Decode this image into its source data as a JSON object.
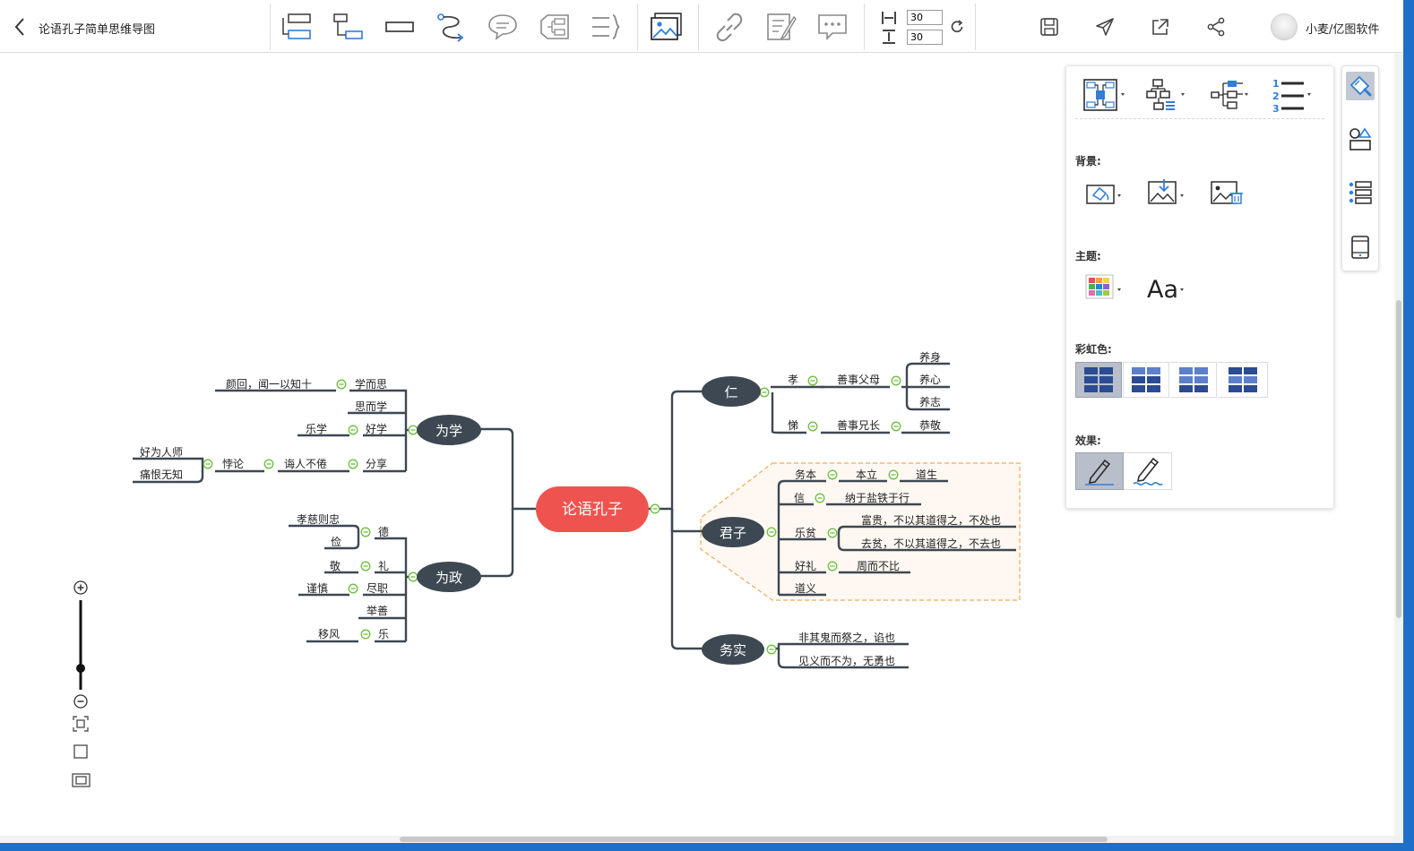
{
  "toolbar": {
    "title": "论语孔子简单思维导图",
    "spacing_h": "30",
    "spacing_v": "30",
    "user": "小麦/亿图软件"
  },
  "panel": {
    "background_label": "背景:",
    "theme_label": "主题:",
    "theme_font_glyph": "Aa",
    "rainbow_label": "彩虹色:",
    "effect_label": "效果:",
    "numbering_glyphs": [
      "1",
      "2",
      "3"
    ]
  },
  "mindmap": {
    "root": "论语孔子",
    "branches": {
      "weixue": "为学",
      "weizheng": "为政",
      "ren": "仁",
      "junzi": "君子",
      "wushi": "务实"
    },
    "weixue": {
      "xue_er_si": "学而思",
      "yanhui": "颜回，闻一以知十",
      "si_er_xue": "思而学",
      "hao_xue": "好学",
      "le_xue": "乐学",
      "fen_xiang": "分享",
      "hui_ren": "诲人不倦",
      "bei_lun": "悖论",
      "hao_wei_ren_shi": "好为人师",
      "tong_hen": "痛恨无知"
    },
    "weizheng": {
      "de": "德",
      "xiao_ci": "孝慈则忠",
      "jian": "俭",
      "li": "礼",
      "jing": "敬",
      "jin_zhi": "尽职",
      "jin_shen": "谨慎",
      "ju_shan": "举善",
      "yue": "乐",
      "yi_feng": "移风"
    },
    "ren": {
      "xiao": "孝",
      "shan_fu_mu": "善事父母",
      "yang_shen": "养身",
      "yang_xin": "养心",
      "yang_zhi": "养志",
      "ti": "悌",
      "shan_xiong": "善事兄长",
      "gong_jing": "恭敬"
    },
    "junzi": {
      "wu_ben": "务本",
      "ben_li": "本立",
      "dao_sheng": "道生",
      "xin": "信",
      "na_yu": "纳于盐铁于行",
      "le_pin": "乐贫",
      "fu_gui": "富贵，不以其道得之，不处也",
      "qu_pin": "去贫，不以其道得之，不去也",
      "hao_li": "好礼",
      "zhou_er": "周而不比",
      "dao_yi": "道义"
    },
    "wushi": {
      "fei_gui": "非其鬼而祭之，谄也",
      "jian_yi": "见义而不为，无勇也"
    }
  },
  "colors": {
    "root_fill": "#ef5350",
    "branch_fill": "#3d4852",
    "line": "#3d4852",
    "collapse_dot": "#6cbf3c",
    "junzi_boundary": "#f3a95a",
    "icon_blue": "#2f7fd8",
    "icon_gray": "#6b6b6b",
    "rainbow_dark": "#2b4c92",
    "rainbow_light": "#5e80c8"
  }
}
